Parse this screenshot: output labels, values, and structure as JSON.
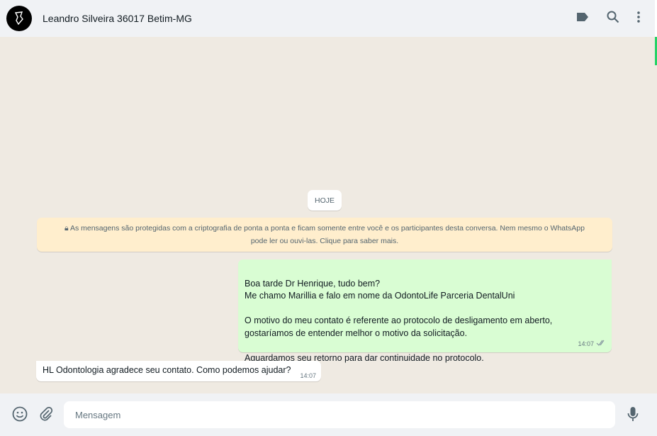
{
  "header": {
    "contact_name": "Leandro Silveira 36017 Betim-MG"
  },
  "chat": {
    "date_divider": "HOJE",
    "encryption_notice_line1": "As mensagens são protegidas com a criptografia de ponta a ponta e ficam somente entre você e os participantes desta conversa. Nem mesmo o WhatsApp",
    "encryption_notice_line2": "pode ler ou ouvi-las. Clique para saber mais.",
    "messages": [
      {
        "direction": "outgoing",
        "text": "Boa tarde Dr Henrique, tudo bem?\nMe chamo Marillia e falo em nome da OdontoLife Parceria DentalUni\n\nO motivo do meu contato é referente ao protocolo de desligamento em aberto,\ngostaríamos de entender melhor o motivo da solicitação.\n\nAguardamos seu retorno para dar continuidade no protocolo.",
        "time": "14:07",
        "status": "read"
      },
      {
        "direction": "incoming",
        "text": "HL Odontologia agradece seu contato. Como podemos ajudar?",
        "time": "14:07"
      }
    ]
  },
  "composer": {
    "placeholder": "Mensagem",
    "value": ""
  },
  "colors": {
    "outgoing": "#d9fdd3",
    "notice": "#ffeecd",
    "accent": "#25d366"
  }
}
